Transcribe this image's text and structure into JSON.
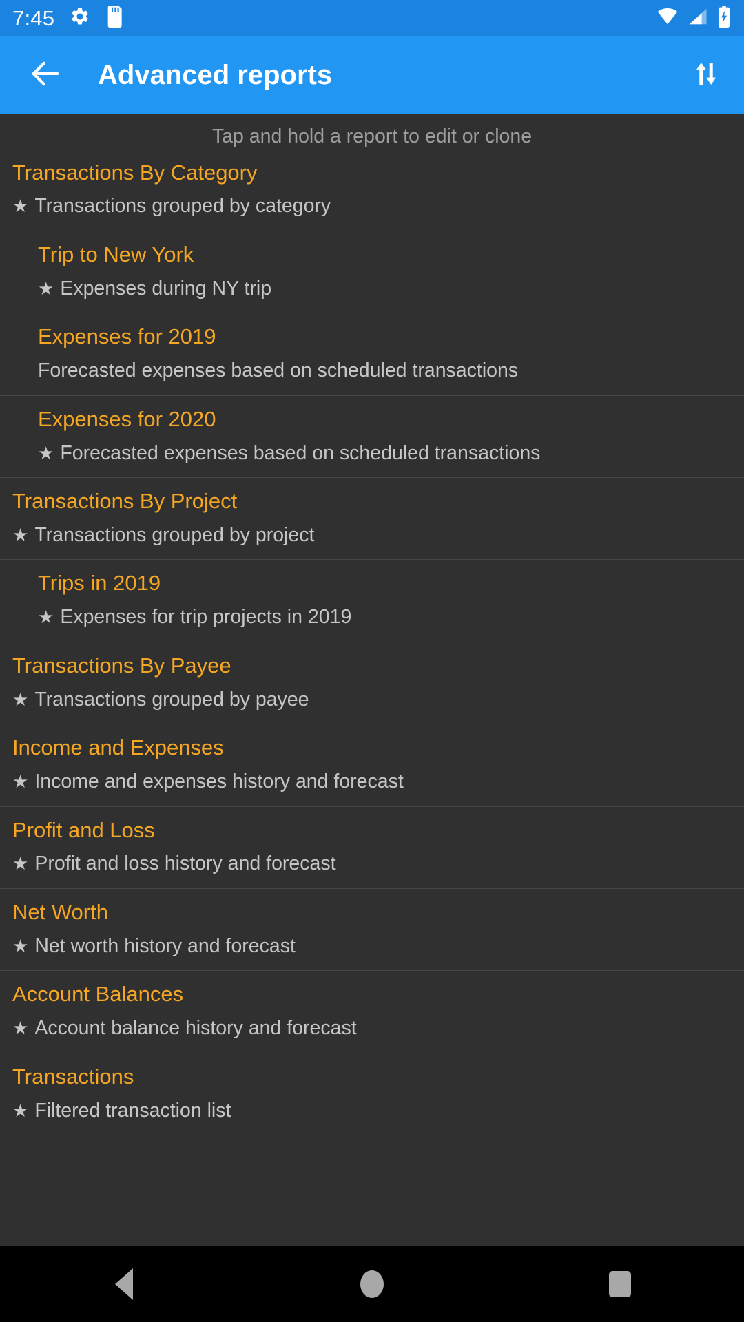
{
  "status_bar": {
    "time": "7:45",
    "icons": [
      "settings-gear-icon",
      "sd-card-icon"
    ],
    "right_icons": [
      "wifi-icon",
      "cell-signal-icon",
      "battery-charging-icon"
    ],
    "background": "#1a84e0"
  },
  "app_bar": {
    "title": "Advanced reports",
    "back_icon": "back-arrow-icon",
    "sort_icon": "sort-updown-icon",
    "background": "#2196f3"
  },
  "content": {
    "hint": "Tap and hold a report to edit or clone",
    "accent_color": "#f5a623",
    "background": "#303030",
    "reports": [
      {
        "title": "Transactions By Category",
        "subtitle": "Transactions grouped by category",
        "starred": true,
        "level": 0
      },
      {
        "title": "Trip to New York",
        "subtitle": "Expenses during NY trip",
        "starred": true,
        "level": 1
      },
      {
        "title": "Expenses for 2019",
        "subtitle": "Forecasted expenses based on scheduled transactions",
        "starred": false,
        "level": 1
      },
      {
        "title": "Expenses for 2020",
        "subtitle": "Forecasted expenses based on scheduled transactions",
        "starred": true,
        "level": 1
      },
      {
        "title": "Transactions By Project",
        "subtitle": "Transactions grouped by project",
        "starred": true,
        "level": 0
      },
      {
        "title": "Trips in 2019",
        "subtitle": "Expenses for trip projects in 2019",
        "starred": true,
        "level": 1
      },
      {
        "title": "Transactions By Payee",
        "subtitle": "Transactions grouped by payee",
        "starred": true,
        "level": 0
      },
      {
        "title": "Income and Expenses",
        "subtitle": "Income and expenses history and forecast",
        "starred": true,
        "level": 0
      },
      {
        "title": "Profit and Loss",
        "subtitle": "Profit and loss history and forecast",
        "starred": true,
        "level": 0
      },
      {
        "title": "Net Worth",
        "subtitle": "Net worth history and forecast",
        "starred": true,
        "level": 0
      },
      {
        "title": "Account Balances",
        "subtitle": "Account balance history and forecast",
        "starred": true,
        "level": 0
      },
      {
        "title": "Transactions",
        "subtitle": "Filtered transaction list",
        "starred": true,
        "level": 0
      }
    ],
    "star_glyph": "★"
  },
  "nav_bar": {
    "back_label": "Back",
    "home_label": "Home",
    "recents_label": "Recents",
    "background": "#000000"
  }
}
